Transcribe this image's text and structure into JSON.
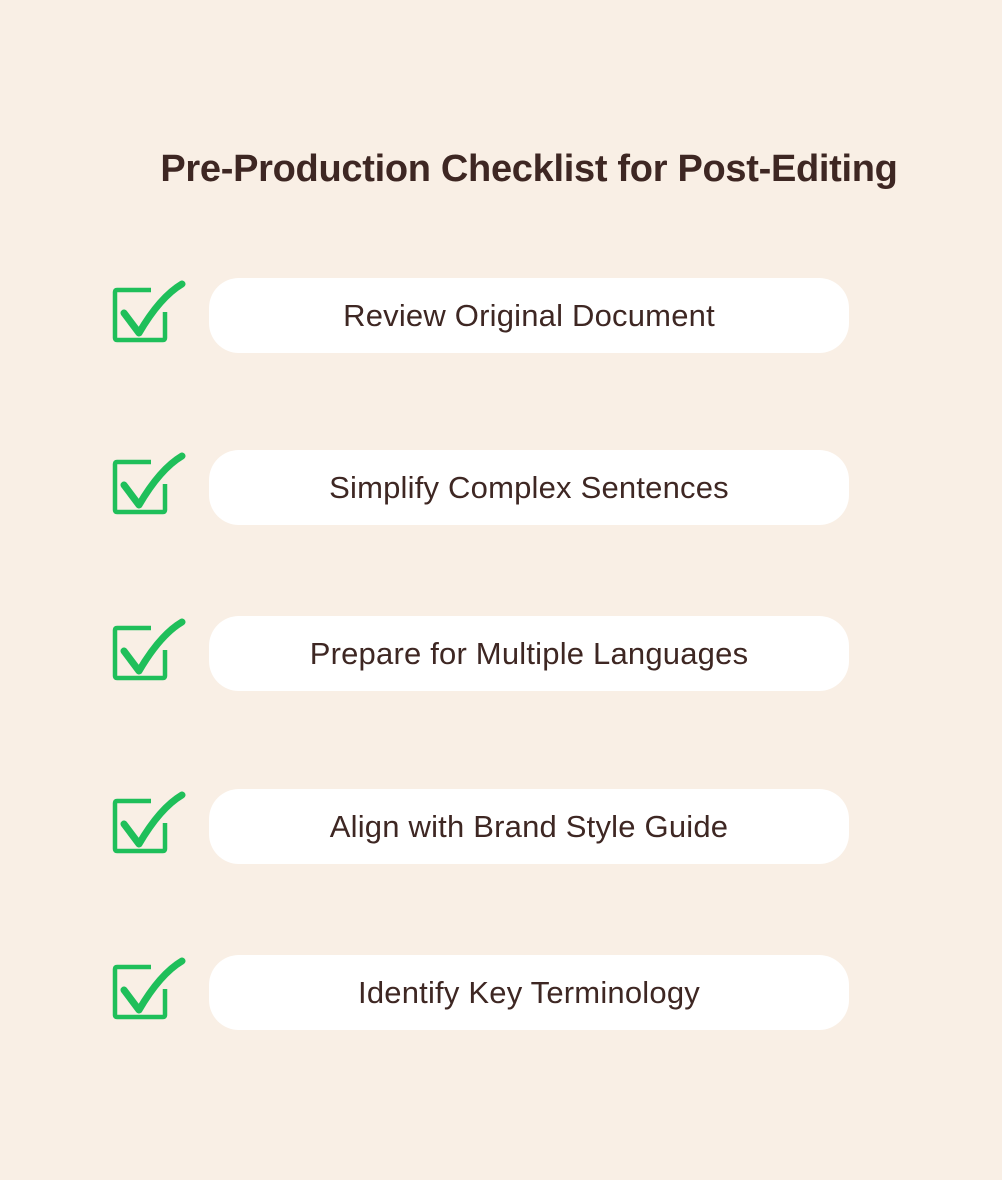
{
  "title": "Pre-Production Checklist for Post-Editing",
  "colors": {
    "background": "#f9efe5",
    "text": "#3e2723",
    "check": "#1fbf5a",
    "pill": "#ffffff"
  },
  "checklist": [
    {
      "label": "Review Original Document",
      "checked": true,
      "icon": "checkbox-checked-icon"
    },
    {
      "label": "Simplify Complex Sentences",
      "checked": true,
      "icon": "checkbox-checked-icon"
    },
    {
      "label": "Prepare for Multiple Languages",
      "checked": true,
      "icon": "checkbox-checked-icon"
    },
    {
      "label": "Align with Brand Style Guide",
      "checked": true,
      "icon": "checkbox-checked-icon"
    },
    {
      "label": "Identify Key Terminology",
      "checked": true,
      "icon": "checkbox-checked-icon"
    }
  ]
}
